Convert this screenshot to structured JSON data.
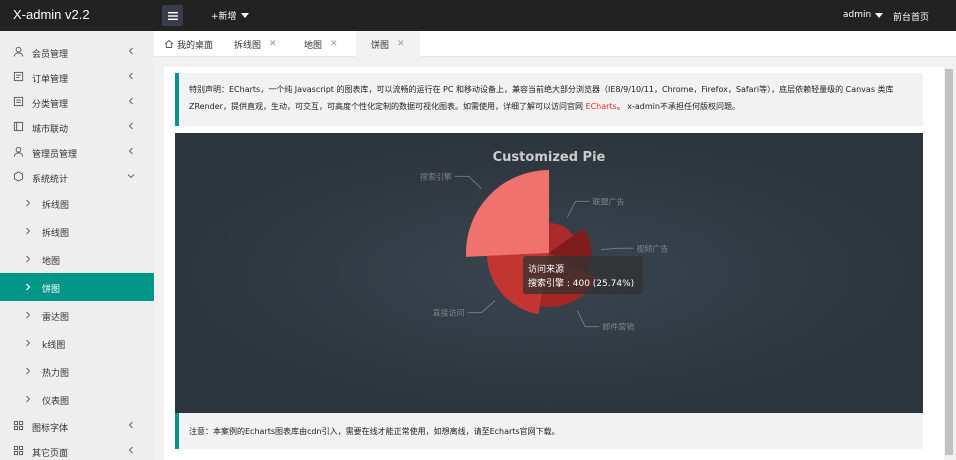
{
  "header": {
    "logo": "X-admin v2.2",
    "add_label": "+新增",
    "user": "admin",
    "front_link": "前台首页"
  },
  "sidebar": {
    "items": [
      {
        "label": "会员管理",
        "icon": "user-icon"
      },
      {
        "label": "订单管理",
        "icon": "order-icon"
      },
      {
        "label": "分类管理",
        "icon": "category-icon"
      },
      {
        "label": "城市联动",
        "icon": "city-icon"
      },
      {
        "label": "管理员管理",
        "icon": "admin-icon"
      },
      {
        "label": "系统统计",
        "icon": "stats-icon"
      }
    ],
    "sub_items": [
      {
        "label": "拆线图"
      },
      {
        "label": "拆线图"
      },
      {
        "label": "地图"
      },
      {
        "label": "饼图"
      },
      {
        "label": "雷达图"
      },
      {
        "label": "k线图"
      },
      {
        "label": "热力图"
      },
      {
        "label": "仪表图"
      }
    ],
    "bottom_items": [
      {
        "label": "图标字体",
        "icon": "grid-icon"
      },
      {
        "label": "其它页面",
        "icon": "grid-icon"
      }
    ]
  },
  "tabs": [
    {
      "label": "我的桌面"
    },
    {
      "label": "拆线图"
    },
    {
      "label": "地图"
    },
    {
      "label": "饼图"
    }
  ],
  "notice": {
    "text_before": "特别声明：ECharts，一个纯 Javascript 的图表库，可以流畅的运行在 PC 和移动设备上，兼容当前绝大部分浏览器（IE8/9/10/11，Chrome，Firefox，Safari等），底层依赖轻量级的 Canvas 类库 ZRender，提供直观，生动，可交互，可高度个性化定制的数据可视化图表。如需使用，详细了解可以访问官网",
    "link": "ECharts",
    "text_after": "。 x-admin不承担任何版权问题。"
  },
  "notice2": "注意：本案例的Echarts图表库由cdn引入，需要在线才能正常使用，如想离线，请至Echarts官网下载。",
  "colors": {
    "accent": "#009688",
    "header_bg": "#222222",
    "chart_bg": "#2c343c",
    "brand_red": "#e42c2c"
  },
  "chart_data": {
    "type": "pie",
    "title": "Customized Pie",
    "series": [
      {
        "name": "访问来源",
        "data": [
          {
            "name": "搜索引擎",
            "value": 400,
            "color": "#f0726c"
          },
          {
            "name": "视频广告",
            "value": 274,
            "color": "#7f1d1d"
          },
          {
            "name": "联盟广告",
            "value": 235,
            "color": "#ab2a2a"
          },
          {
            "name": "邮件营销",
            "value": 310,
            "color": "#a32623"
          },
          {
            "name": "直接访问",
            "value": 335,
            "color": "#c23531"
          }
        ]
      }
    ],
    "tooltip": {
      "title": "访问来源",
      "text": "搜索引擎 : 400 (25.74%)"
    }
  }
}
